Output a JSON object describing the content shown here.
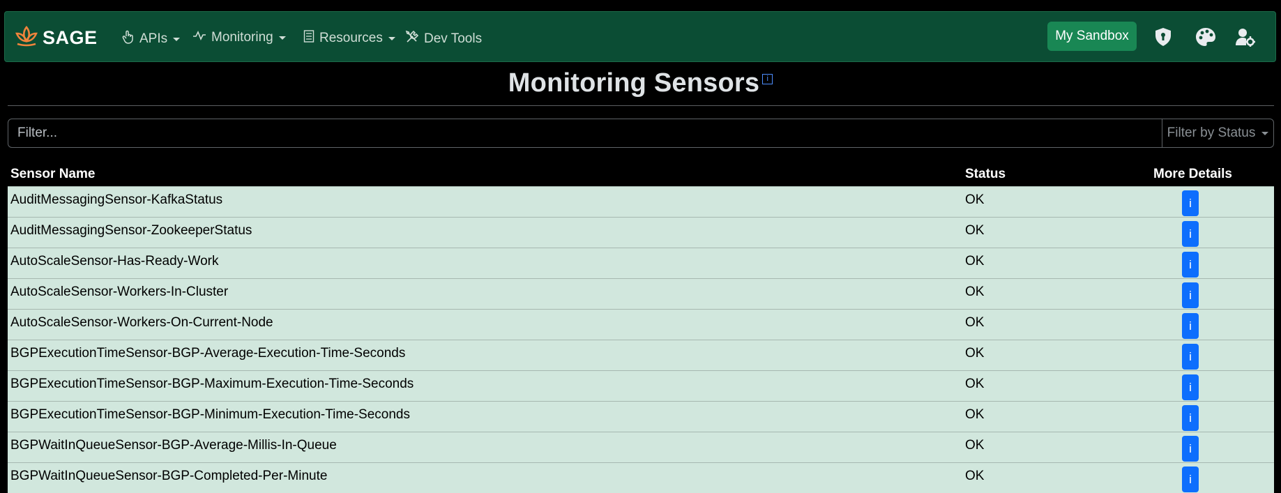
{
  "navbar": {
    "brand": "SAGE",
    "brand_color": "#f0843c",
    "items": [
      {
        "label": "APIs",
        "icon": "pointer-hand-icon",
        "dropdown": true
      },
      {
        "label": "Monitoring",
        "icon": "pulse-icon",
        "dropdown": true
      },
      {
        "label": "Resources",
        "icon": "list-icon",
        "dropdown": true
      },
      {
        "label": "Dev Tools",
        "icon": "tools-icon",
        "dropdown": false
      }
    ],
    "sandbox_label": "My Sandbox",
    "right_icons": [
      "shield-icon",
      "palette-icon",
      "user-settings-icon"
    ]
  },
  "page": {
    "title": "Monitoring Sensors",
    "info_badge": "i"
  },
  "filter": {
    "placeholder": "Filter...",
    "status_label": "Filter by Status"
  },
  "table": {
    "headers": {
      "name": "Sensor Name",
      "status": "Status",
      "details": "More Details"
    },
    "details_button": "i",
    "row_color": "#d1e7dd",
    "rows": [
      {
        "name": "AuditMessagingSensor-KafkaStatus",
        "status": "OK"
      },
      {
        "name": "AuditMessagingSensor-ZookeeperStatus",
        "status": "OK"
      },
      {
        "name": "AutoScaleSensor-Has-Ready-Work",
        "status": "OK"
      },
      {
        "name": "AutoScaleSensor-Workers-In-Cluster",
        "status": "OK"
      },
      {
        "name": "AutoScaleSensor-Workers-On-Current-Node",
        "status": "OK"
      },
      {
        "name": "BGPExecutionTimeSensor-BGP-Average-Execution-Time-Seconds",
        "status": "OK"
      },
      {
        "name": "BGPExecutionTimeSensor-BGP-Maximum-Execution-Time-Seconds",
        "status": "OK"
      },
      {
        "name": "BGPExecutionTimeSensor-BGP-Minimum-Execution-Time-Seconds",
        "status": "OK"
      },
      {
        "name": "BGPWaitInQueueSensor-BGP-Average-Millis-In-Queue",
        "status": "OK"
      },
      {
        "name": "BGPWaitInQueueSensor-BGP-Completed-Per-Minute",
        "status": "OK"
      }
    ]
  }
}
